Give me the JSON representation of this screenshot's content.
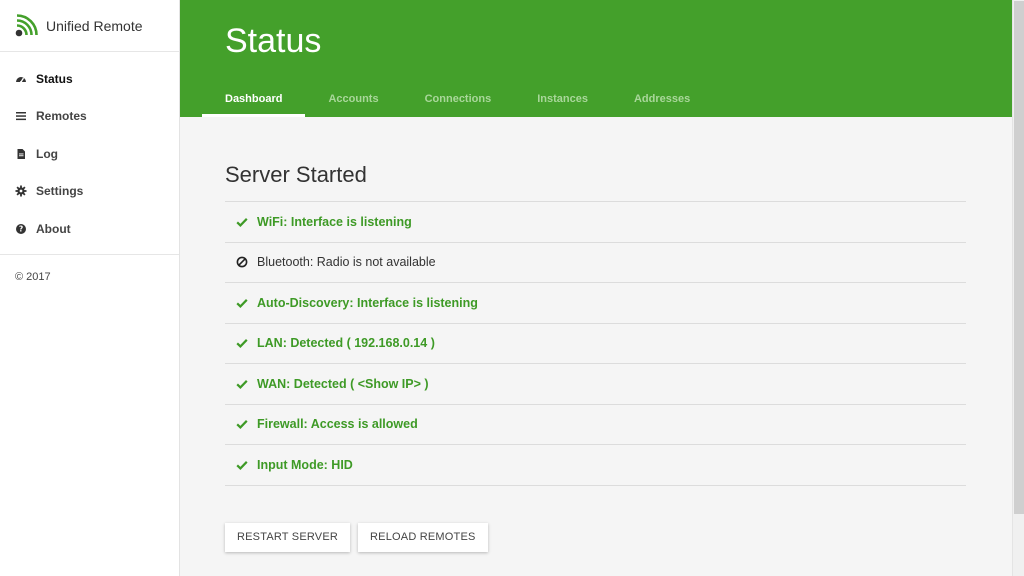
{
  "app": {
    "name": "Unified Remote",
    "logo_icon": "wifi-signal-logo-icon",
    "accent_color": "#44a02b"
  },
  "sidebar": {
    "items": [
      {
        "label": "Status",
        "icon": "dashboard-icon",
        "active": true
      },
      {
        "label": "Remotes",
        "icon": "list-icon"
      },
      {
        "label": "Log",
        "icon": "document-icon"
      },
      {
        "label": "Settings",
        "icon": "gear-icon"
      },
      {
        "label": "About",
        "icon": "question-icon"
      }
    ],
    "copyright": "© 2017"
  },
  "header": {
    "title": "Status",
    "tabs": [
      {
        "label": "Dashboard",
        "active": true
      },
      {
        "label": "Accounts"
      },
      {
        "label": "Connections"
      },
      {
        "label": "Instances"
      },
      {
        "label": "Addresses"
      }
    ]
  },
  "main": {
    "section_title": "Server Started",
    "status_items": [
      {
        "text": "WiFi: Interface is listening",
        "state": "ok",
        "icon": "check-icon"
      },
      {
        "text": "Bluetooth: Radio is not available",
        "state": "na",
        "icon": "ban-icon"
      },
      {
        "text": "Auto-Discovery: Interface is listening",
        "state": "ok",
        "icon": "check-icon"
      },
      {
        "text": "LAN: Detected ( 192.168.0.14 )",
        "state": "ok",
        "icon": "check-icon"
      },
      {
        "text": "WAN: Detected ( <Show IP> )",
        "state": "ok",
        "icon": "check-icon"
      },
      {
        "text": "Firewall: Access is allowed",
        "state": "ok",
        "icon": "check-icon"
      },
      {
        "text": "Input Mode: HID",
        "state": "ok",
        "icon": "check-icon"
      }
    ],
    "buttons": {
      "restart": "RESTART SERVER",
      "reload": "RELOAD REMOTES"
    }
  }
}
